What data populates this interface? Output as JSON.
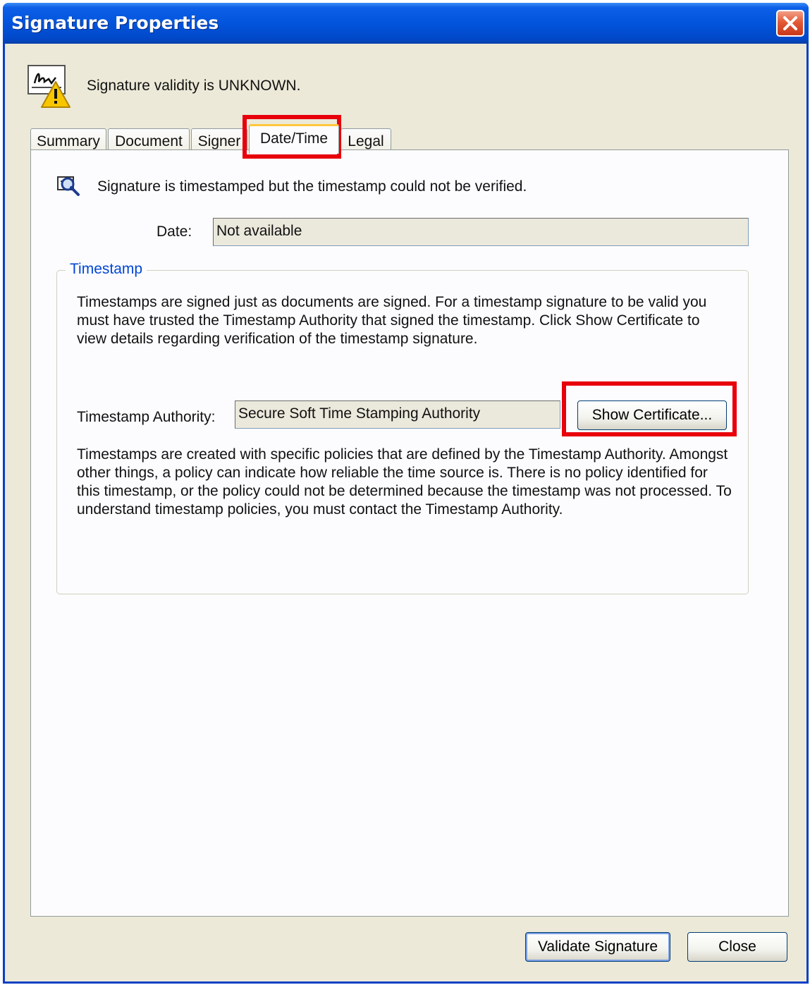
{
  "window": {
    "title": "Signature Properties"
  },
  "status": {
    "text": "Signature validity is UNKNOWN."
  },
  "tabs": [
    {
      "label": "Summary"
    },
    {
      "label": "Document"
    },
    {
      "label": "Signer"
    },
    {
      "label": "Date/Time",
      "active": true
    },
    {
      "label": "Legal"
    }
  ],
  "datetime": {
    "timestamp_status": "Signature is timestamped but the timestamp could not be verified.",
    "date_label": "Date:",
    "date_value": "Not available",
    "group_title": "Timestamp",
    "intro": "Timestamps are signed just as documents are signed. For a timestamp signature to be valid you must have trusted the Timestamp Authority that signed the timestamp. Click Show Certificate to view details regarding verification of the timestamp signature.",
    "authority_label": "Timestamp Authority:",
    "authority_value": "Secure Soft Time Stamping Authority",
    "show_certificate_label": "Show Certificate...",
    "policy_text": "Timestamps are created with specific policies that are defined by the Timestamp Authority. Amongst other things, a policy can indicate how reliable the time source is. There is no policy identified for this timestamp, or the policy could not be determined because the timestamp was not processed. To understand timestamp policies, you must contact the Timestamp Authority."
  },
  "footer": {
    "validate_label": "Validate Signature",
    "close_label": "Close"
  },
  "colors": {
    "titlebar": "#0254dc",
    "highlight": "#e8000b",
    "group_title": "#0046d5"
  }
}
